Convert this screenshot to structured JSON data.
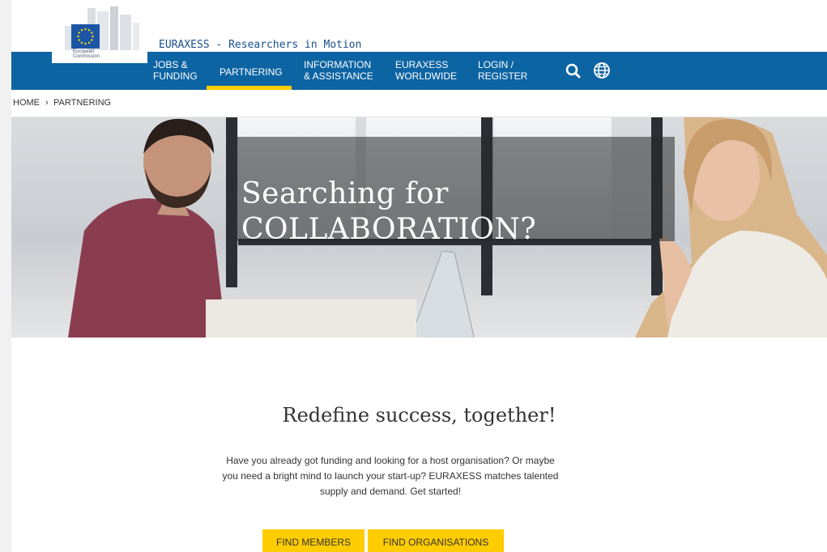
{
  "header": {
    "logo_text_line1": "European",
    "logo_text_line2": "Commission",
    "site_title": "EURAXESS - Researchers in Motion"
  },
  "nav": {
    "jobs_line1": "JOBS &",
    "jobs_line2": "FUNDING",
    "partnering": "PARTNERING",
    "info_line1": "INFORMATION",
    "info_line2": "& ASSISTANCE",
    "worldwide_line1": "EURAXESS",
    "worldwide_line2": "WORLDWIDE",
    "login_line1": "LOGIN /",
    "login_line2": "REGISTER",
    "search_icon": "search-icon",
    "language_icon": "globe-icon"
  },
  "breadcrumb": {
    "home": "HOME",
    "separator": "›",
    "current": "PARTNERING"
  },
  "hero": {
    "line1": "Searching for",
    "line2": "COLLABORATION?"
  },
  "content": {
    "title": "Redefine success, together!",
    "text_line1": "Have you already got funding and looking for a host organisation? Or maybe",
    "text_line2": "you need a bright mind to launch your start-up? EURAXESS matches talented",
    "text_line3": "supply and demand. Get started!"
  },
  "actions": {
    "find_members": "FIND MEMBERS",
    "find_organisations": "FIND ORGANISATIONS"
  },
  "colors": {
    "nav_blue": "#0d64a3",
    "accent_yellow": "#ffcc00",
    "title_blue": "#1a4f8e"
  }
}
